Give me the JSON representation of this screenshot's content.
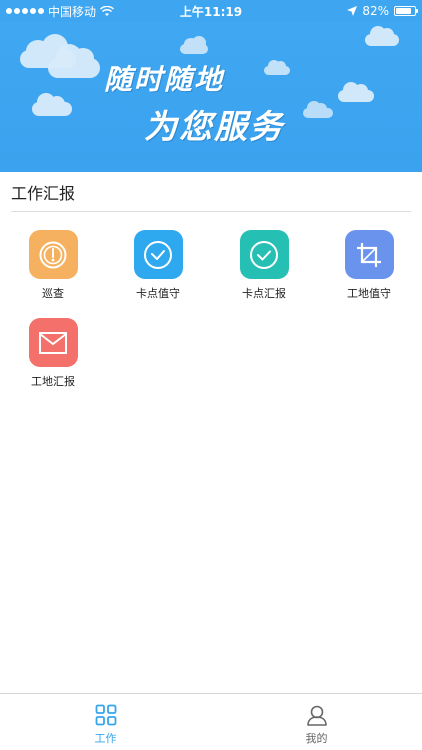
{
  "status_bar": {
    "carrier": "中国移动",
    "time": "上午11:19",
    "battery": "82%",
    "battery_level": 0.82
  },
  "banner": {
    "line1": "随时随地",
    "line2": "为您服务"
  },
  "section": {
    "title": "工作汇报"
  },
  "tiles": [
    {
      "label": "巡查",
      "icon": "gauge-icon",
      "color": "#f5b15f"
    },
    {
      "label": "卡点值守",
      "icon": "clock-check-icon",
      "color": "#2ea8ef"
    },
    {
      "label": "卡点汇报",
      "icon": "check-circle-icon",
      "color": "#26bfb3"
    },
    {
      "label": "工地值守",
      "icon": "crop-icon",
      "color": "#6a93ee"
    },
    {
      "label": "工地汇报",
      "icon": "mail-icon",
      "color": "#f4706a"
    }
  ],
  "tabbar": {
    "tabs": [
      {
        "label": "工作",
        "icon": "grid-icon",
        "active": true,
        "color": "#35a5ec"
      },
      {
        "label": "我的",
        "icon": "user-icon",
        "active": false,
        "color": "#666666"
      }
    ]
  }
}
